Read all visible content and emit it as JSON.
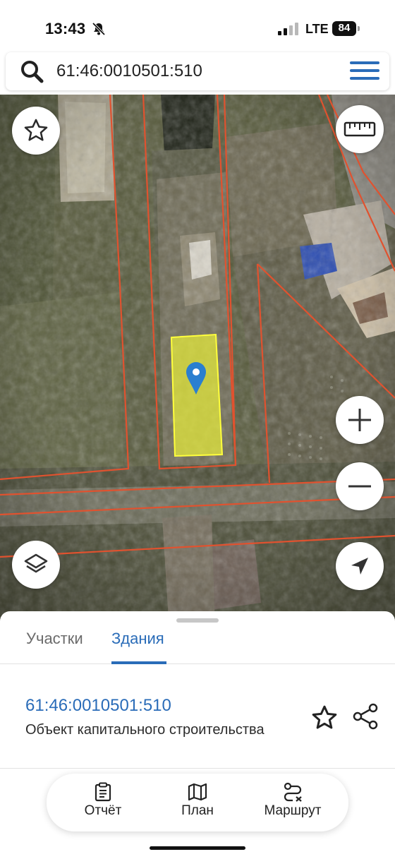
{
  "status_bar": {
    "time": "13:43",
    "mute_icon": "bell-slash-icon",
    "network": "LTE",
    "battery": "84"
  },
  "search": {
    "value": "61:46:0010501:510",
    "icon": "search-icon",
    "menu_icon": "hamburger-menu-icon"
  },
  "map": {
    "buttons": [
      "star-icon",
      "ruler-icon",
      "plus-icon",
      "minus-icon",
      "layers-icon",
      "navigate-arrow-icon"
    ],
    "colors": {
      "boundary": "#e0522f",
      "selection": "#e6ec3a",
      "marker": "#2a7fd0"
    }
  },
  "sheet": {
    "tabs": [
      {
        "label": "Участки",
        "active": false
      },
      {
        "label": "Здания",
        "active": true
      }
    ],
    "result": {
      "cadastral_number": "61:46:0010501:510",
      "object_type": "Объект капитального строительства"
    },
    "actions": [
      {
        "label": "Отчёт",
        "icon": "report-clipboard-icon"
      },
      {
        "label": "План",
        "icon": "map-plan-icon"
      },
      {
        "label": "Маршрут",
        "icon": "route-icon"
      }
    ]
  },
  "colors": {
    "accent": "#2a6cb8",
    "text": "#222222"
  }
}
